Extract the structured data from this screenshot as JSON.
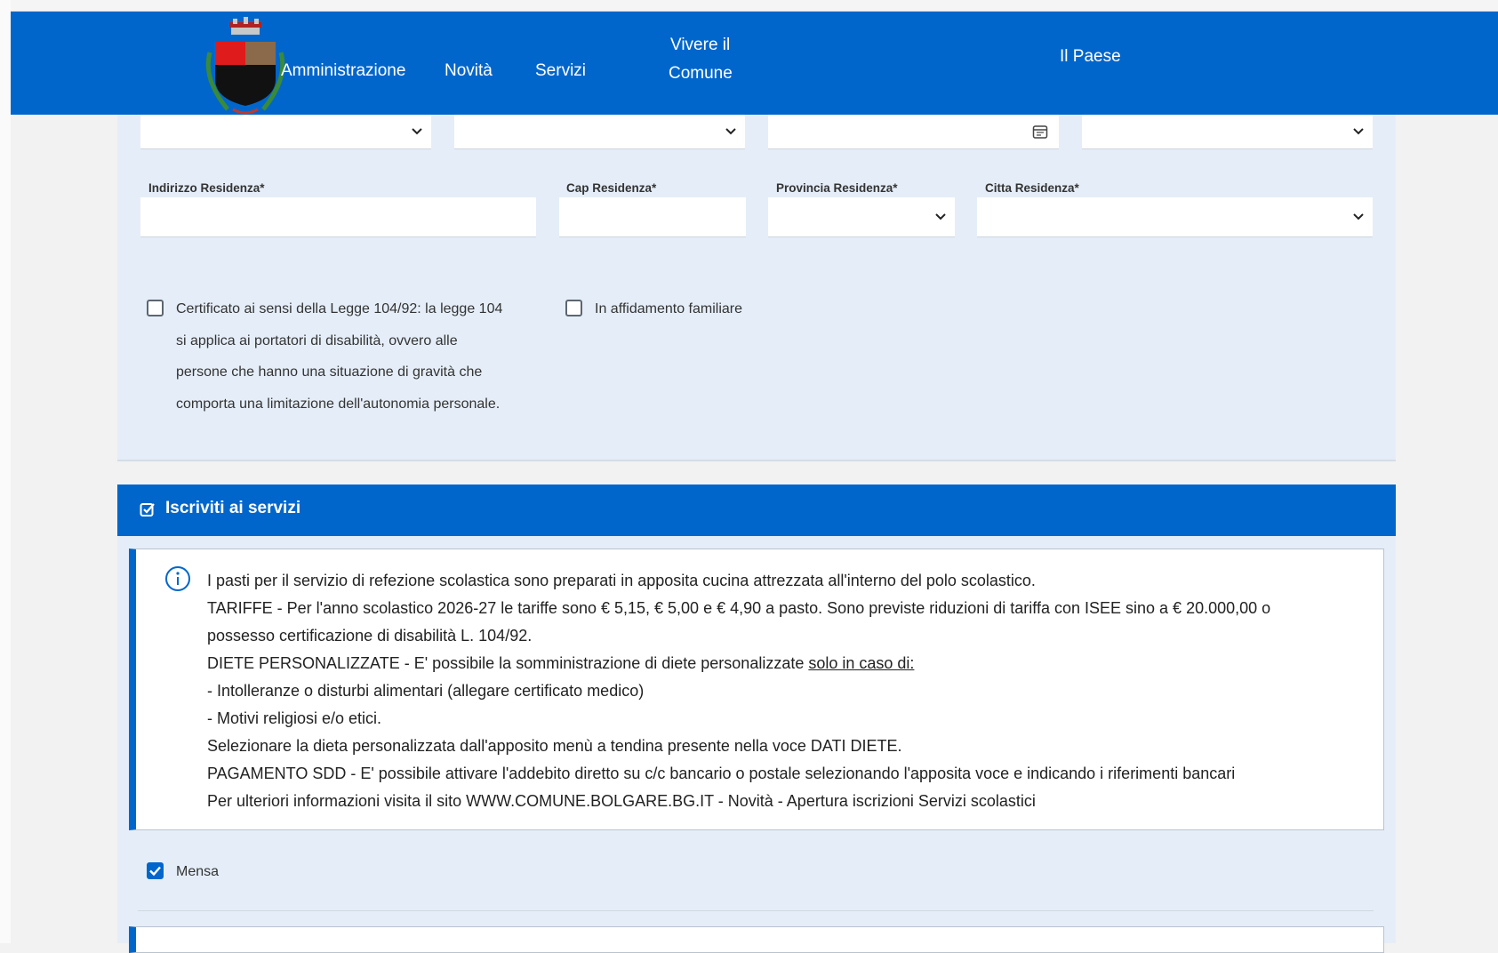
{
  "header": {
    "nav": [
      {
        "label": "Amministrazione"
      },
      {
        "label": "Novità"
      },
      {
        "label": "Servizi"
      },
      {
        "line1": "Vivere il",
        "line2": "Comune"
      },
      {
        "label": "Il Paese"
      }
    ]
  },
  "form": {
    "labels": {
      "indirizzo": "Indirizzo Residenza*",
      "cap": "Cap Residenza*",
      "provincia": "Provincia Residenza*",
      "citta": "Citta Residenza*"
    },
    "checkboxes": [
      {
        "lines": [
          "Certificato ai sensi della Legge 104/92: la legge 104",
          "si applica ai portatori di disabilità, ovvero alle",
          "persone che hanno una situazione di gravità che",
          "comporta una limitazione dell'autonomia personale."
        ],
        "checked": false
      },
      {
        "label": "In affidamento familiare",
        "checked": false
      }
    ]
  },
  "section": {
    "title": "Iscriviti ai servizi",
    "info": {
      "line1": "I pasti per il servizio di refezione scolastica sono preparati in apposita cucina attrezzata all'interno del polo scolastico.",
      "line2": "TARIFFE - Per l'anno scolastico 2026-27 le tariffe sono € 5,15, € 5,00 e € 4,90 a pasto. Sono previste riduzioni di tariffa con ISEE sino a € 20.000,00 o",
      "line3": "possesso certificazione di disabilità L. 104/92.",
      "line4_prefix": "DIETE PERSONALIZZATE - E' possibile la somministrazione di diete personalizzate ",
      "line4_underlined": "solo in caso di:",
      "line5": "- Intolleranze o disturbi alimentari (allegare certificato medico)",
      "line6": "- Motivi religiosi e/o etici.",
      "line7": "Selezionare la dieta personalizzata dall'apposito menù a tendina presente nella voce DATI DIETE.",
      "line8": "PAGAMENTO SDD - E' possibile attivare l'addebito diretto su c/c bancario o postale selezionando l'apposita voce e indicando i riferimenti bancari",
      "line9": "Per ulteriori informazioni visita il sito WWW.COMUNE.BOLGARE.BG.IT  - Novità -  Apertura iscrizioni Servizi scolastici"
    },
    "services": [
      {
        "label": "Mensa",
        "checked": true
      }
    ]
  },
  "colors": {
    "primary": "#0066cc",
    "panel": "#e5eef8",
    "page": "#f2f2f2"
  }
}
